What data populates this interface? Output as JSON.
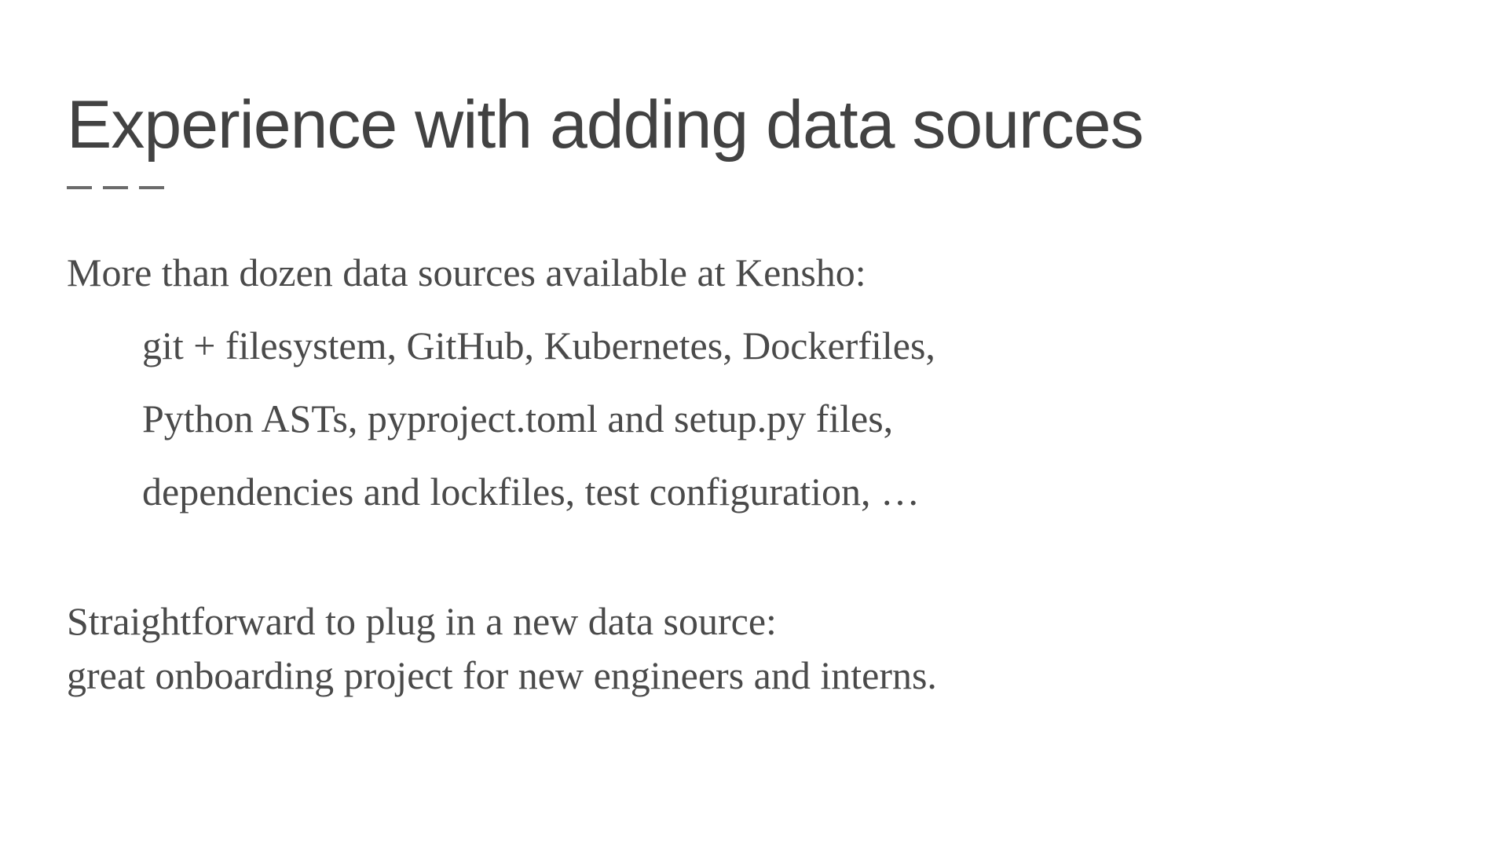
{
  "slide": {
    "title": "Experience with adding data sources",
    "intro": "More than dozen data sources available at Kensho:",
    "list_line1": "git + filesystem, GitHub, Kubernetes, Dockerfiles,",
    "list_line2": "Python ASTs, pyproject.toml and setup.py files,",
    "list_line3": "dependencies and lockfiles, test configuration, …",
    "para2_line1": "Straightforward to plug in a new data source:",
    "para2_line2": "great onboarding project for new engineers and interns."
  }
}
